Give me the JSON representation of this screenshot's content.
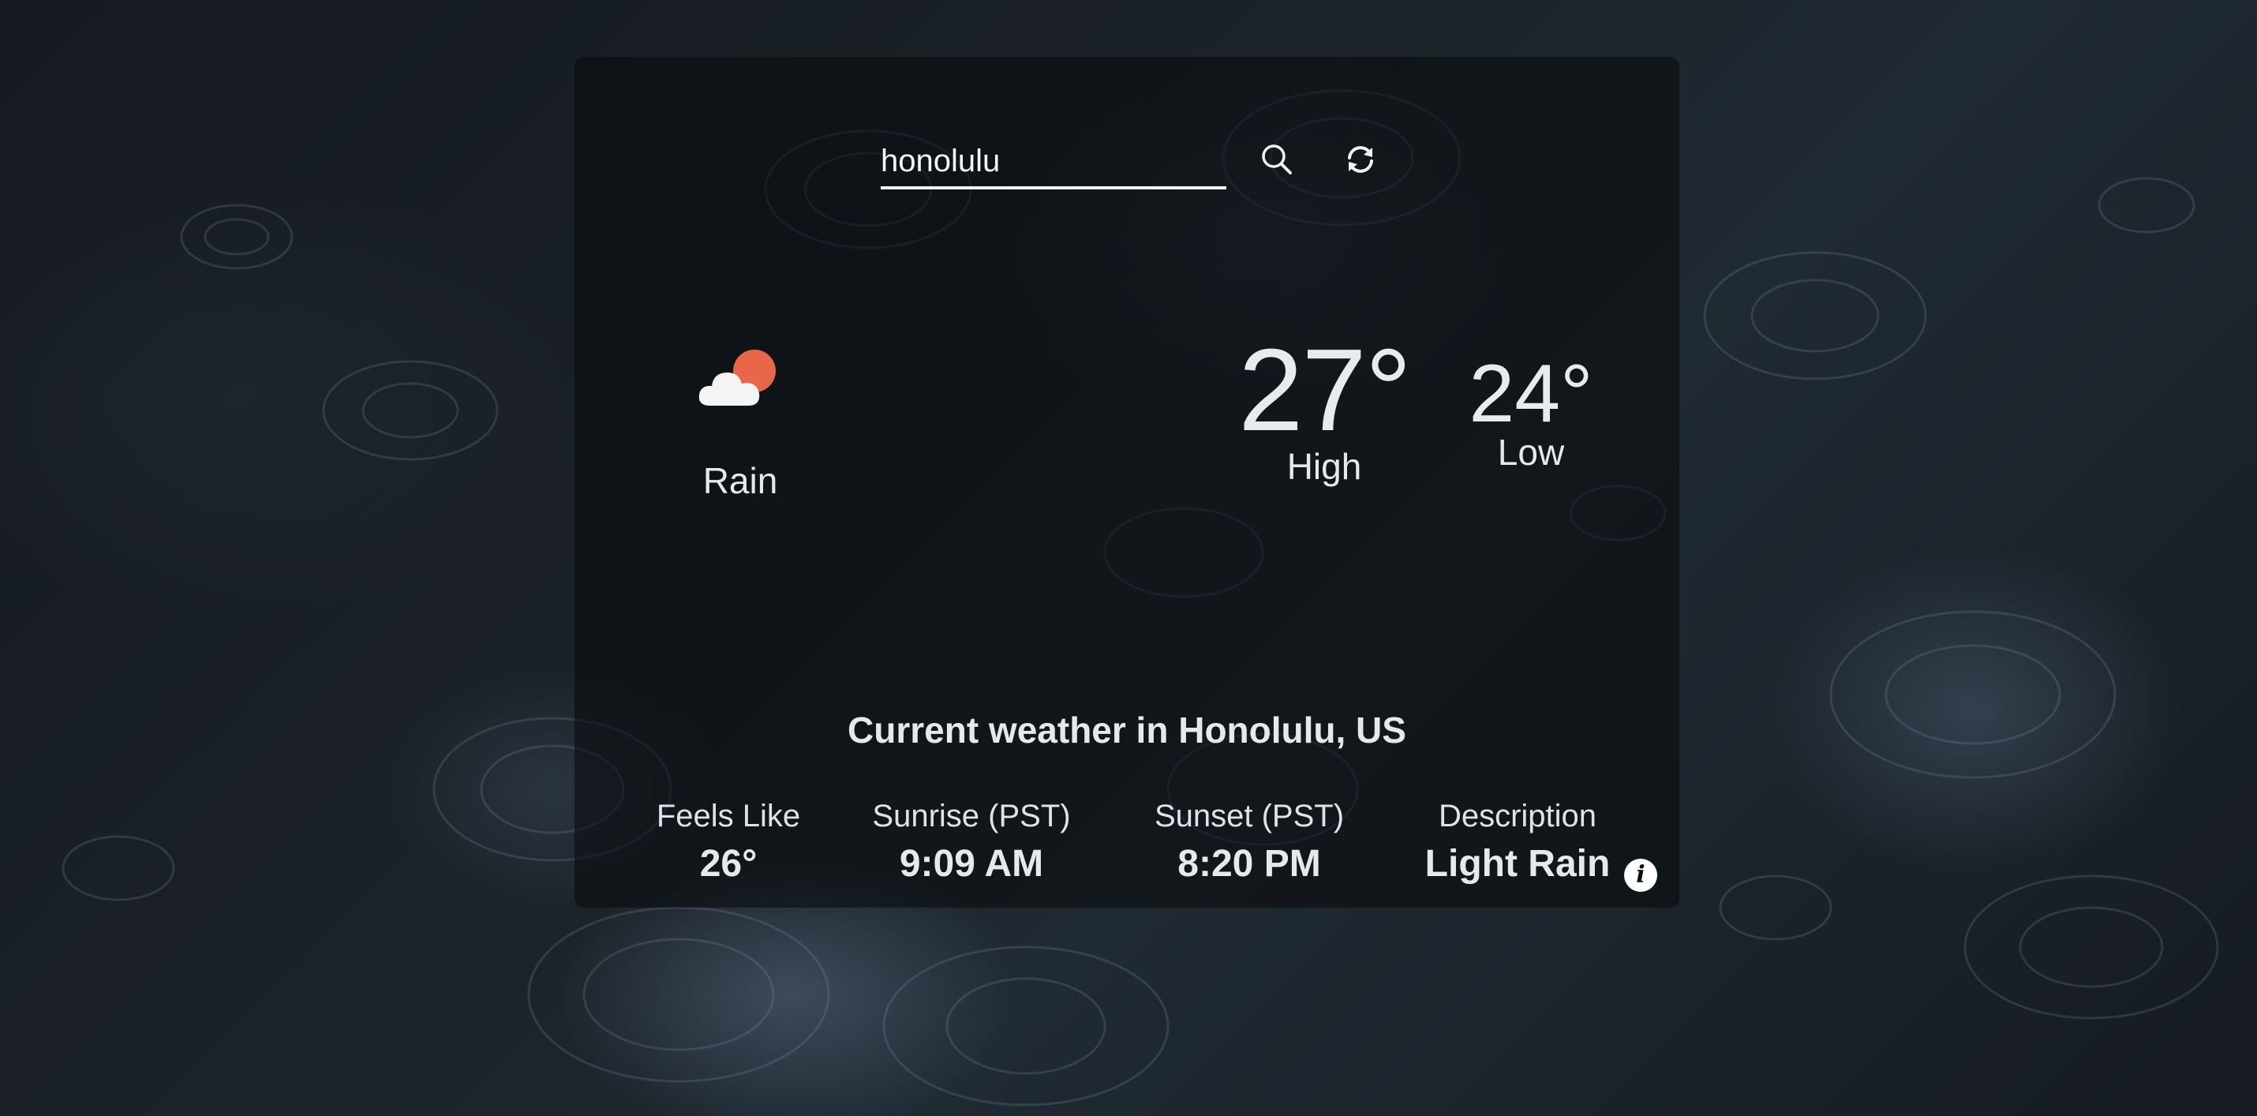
{
  "search": {
    "value": "honolulu",
    "icon": "search-icon",
    "refresh_icon": "refresh-icon"
  },
  "current": {
    "icon": "partly-cloudy-icon",
    "condition": "Rain",
    "high": "27°",
    "high_label": "High",
    "low": "24°",
    "low_label": "Low"
  },
  "location_heading": "Current weather in Honolulu, US",
  "stats": [
    {
      "label": "Feels Like",
      "value": "26°"
    },
    {
      "label": "Sunrise (PST)",
      "value": "9:09 AM"
    },
    {
      "label": "Sunset (PST)",
      "value": "8:20 PM"
    },
    {
      "label": "Description",
      "value": "Light Rain"
    }
  ],
  "info": {
    "icon": "info-icon",
    "glyph": "i"
  },
  "colors": {
    "sun": "#e8674a",
    "cloud": "#f4f4f4",
    "card_overlay": "rgba(8,10,12,0.58)"
  }
}
